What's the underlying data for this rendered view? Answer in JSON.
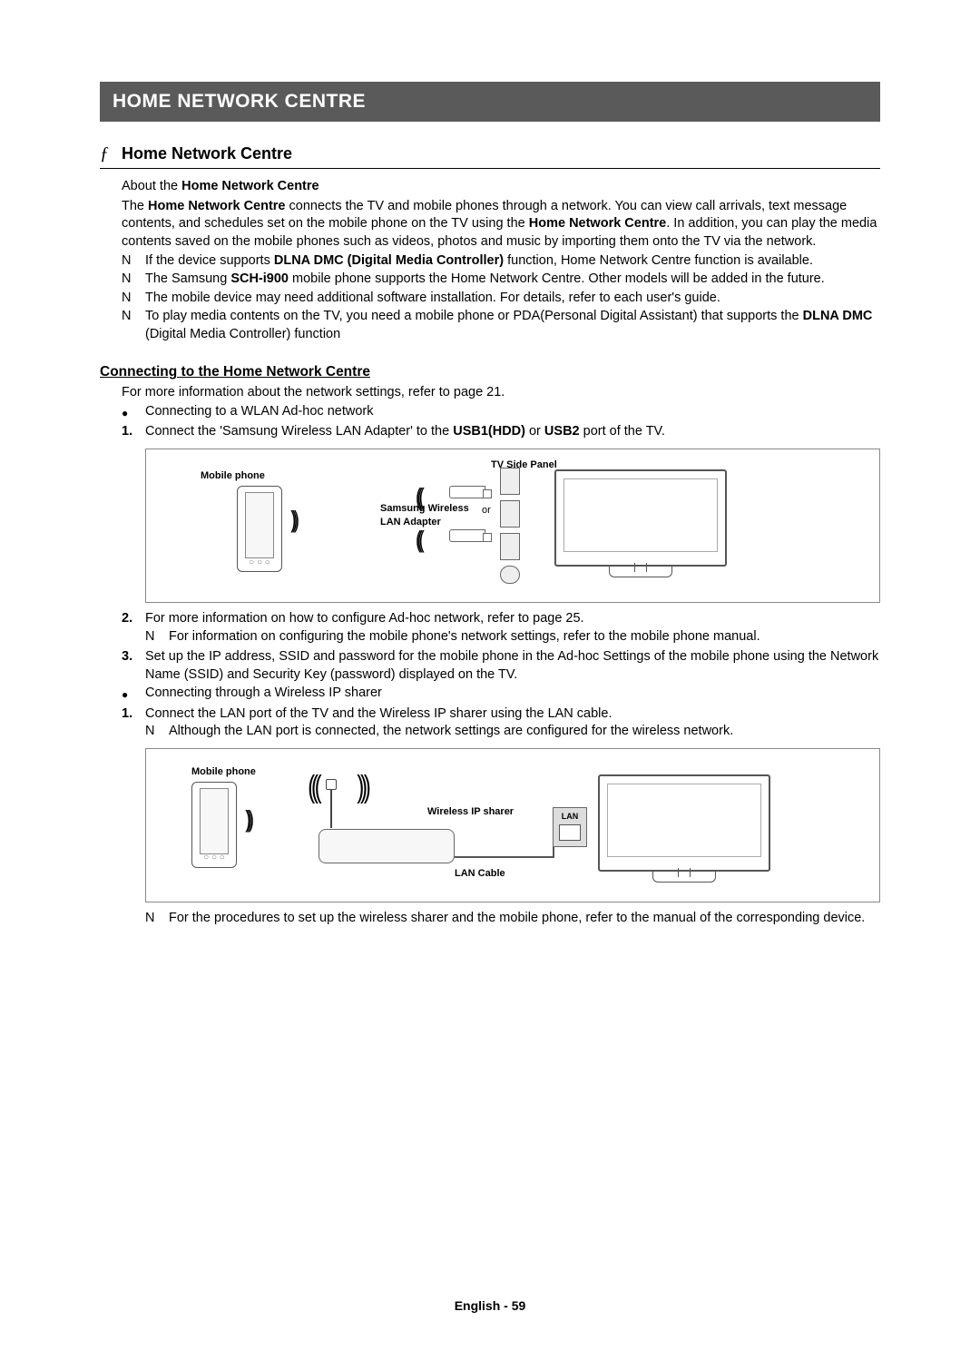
{
  "banner": "HOME NETWORK CENTRE",
  "section_sym": "ƒ",
  "section_title": "Home Network Centre",
  "about": {
    "prefix": "About the ",
    "bold": "Home Network Centre",
    "p1a": "The ",
    "p1b": "Home Network Centre",
    "p1c": " connects the TV and mobile phones through a network. You can view call arrivals, text message contents, and schedules set on the mobile phone on the TV using the ",
    "p1d": "Home Network Centre",
    "p1e": ". In addition, you can play the media contents saved on the mobile phones such as videos, photos and music by importing them onto the TV via the network."
  },
  "note_mark": "N",
  "notes": {
    "n1a": "If the device supports ",
    "n1b": "DLNA DMC (Digital Media Controller)",
    "n1c": " function, Home Network Centre function is available.",
    "n2a": "The Samsung ",
    "n2b": "SCH-i900",
    "n2c": " mobile phone supports the Home Network Centre. Other models will be added in the future.",
    "n3": "The mobile device may need additional software installation. For details, refer to each user's guide.",
    "n4a": "To play media contents on the TV, you need a mobile phone or PDA(Personal Digital Assistant) that supports the ",
    "n4b": "DLNA DMC",
    "n4c": " (Digital Media Controller) function"
  },
  "subhead": "Connecting to the Home Network Centre",
  "line_info": "For more information about the network settings, refer to page 21.",
  "bullet1": "Connecting to a WLAN Ad-hoc network",
  "step1a": "Connect the 'Samsung Wireless LAN Adapter' to the ",
  "step1b": "USB1(HDD)",
  "step1c": " or ",
  "step1d": "USB2",
  "step1e": " port of the TV.",
  "num1": "1.",
  "num2": "2.",
  "num3": "3.",
  "diagram1": {
    "mobile": "Mobile phone",
    "adapter": "Samsung Wireless LAN Adapter",
    "panel": "TV Side Panel",
    "or": "or"
  },
  "step2": "For more information on how to configure Ad-hoc network, refer to page 25.",
  "step2_note": "For information on configuring the mobile phone's network settings, refer to the mobile phone manual.",
  "step3": "Set up the IP address, SSID and password for the mobile phone in the Ad-hoc Settings of the mobile phone using the Network Name (SSID) and Security Key (password) displayed on the TV.",
  "bullet2": "Connecting through a Wireless IP sharer",
  "stepB1": "Connect the LAN port of the TV and the Wireless IP sharer using the LAN cable.",
  "stepB1_note": "Although the LAN port is connected, the network settings are configured for the wireless network.",
  "diagram2": {
    "mobile": "Mobile phone",
    "sharer": "Wireless IP sharer",
    "cable": "LAN Cable",
    "lan": "LAN"
  },
  "final_note": "For the procedures to set up the wireless sharer and the mobile phone, refer to the manual of the corresponding device.",
  "footer": "English - 59"
}
